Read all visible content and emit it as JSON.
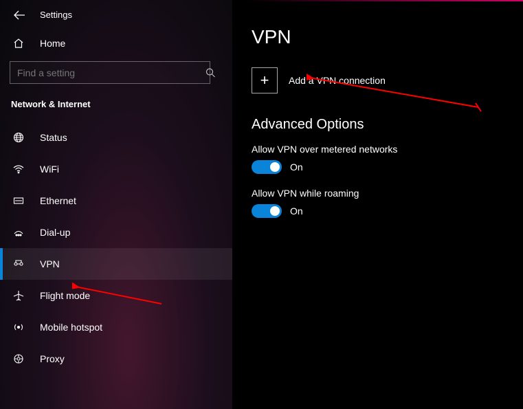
{
  "header": {
    "title": "Settings"
  },
  "home": {
    "label": "Home"
  },
  "search": {
    "placeholder": "Find a setting"
  },
  "section": {
    "title": "Network & Internet"
  },
  "nav": {
    "items": [
      {
        "label": "Status"
      },
      {
        "label": "WiFi"
      },
      {
        "label": "Ethernet"
      },
      {
        "label": "Dial-up"
      },
      {
        "label": "VPN"
      },
      {
        "label": "Flight mode"
      },
      {
        "label": "Mobile hotspot"
      },
      {
        "label": "Proxy"
      }
    ],
    "selected_index": 4
  },
  "main": {
    "title": "VPN",
    "add_label": "Add a VPN connection",
    "advanced_heading": "Advanced Options",
    "options": [
      {
        "label": "Allow VPN over metered networks",
        "state": "On",
        "on": true
      },
      {
        "label": "Allow VPN while roaming",
        "state": "On",
        "on": true
      }
    ]
  },
  "colors": {
    "accent": "#0a84d8",
    "annotation": "#ff0000"
  }
}
